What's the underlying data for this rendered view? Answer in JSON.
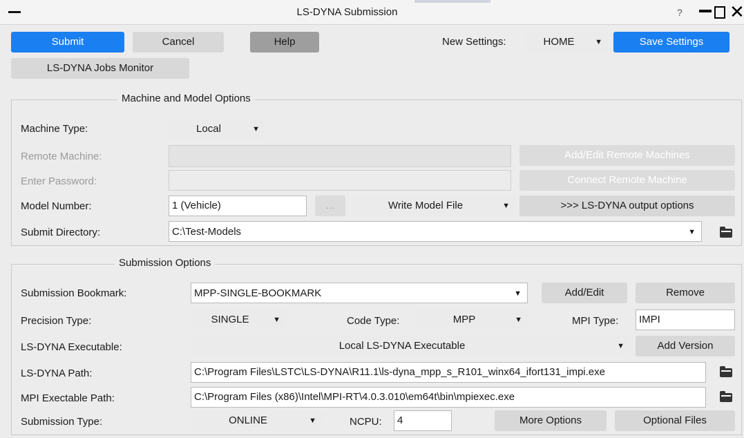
{
  "window": {
    "title": "LS-DYNA Submission",
    "help_glyph": "?",
    "close_glyph": "✕"
  },
  "toolbar": {
    "submit": "Submit",
    "cancel": "Cancel",
    "help": "Help",
    "new_settings_label": "New Settings:",
    "new_settings_value": "HOME",
    "save_settings": "Save Settings",
    "jobs_monitor": "LS-DYNA Jobs Monitor"
  },
  "machine": {
    "section_title": "Machine and Model Options",
    "machine_type_label": "Machine Type:",
    "machine_type_value": "Local",
    "remote_machine_label": "Remote Machine:",
    "add_edit_remote": "Add/Edit Remote Machines",
    "enter_password_label": "Enter Password:",
    "connect_remote": "Connect Remote Machine",
    "model_number_label": "Model Number:",
    "model_number_value": "1 (Vehicle)",
    "ellipsis": "...",
    "write_model_value": "Write Model File",
    "output_options": ">>> LS-DYNA output options",
    "submit_dir_label": "Submit Directory:",
    "submit_dir_value": "C:\\Test-Models"
  },
  "submission": {
    "section_title": "Submission Options",
    "bookmark_label": "Submission Bookmark:",
    "bookmark_value": "MPP-SINGLE-BOOKMARK",
    "add_edit": "Add/Edit",
    "remove": "Remove",
    "precision_label": "Precision Type:",
    "precision_value": "SINGLE",
    "code_type_label": "Code Type:",
    "code_type_value": "MPP",
    "mpi_type_label": "MPI Type:",
    "mpi_type_value": "IMPI",
    "executable_label": "LS-DYNA Executable:",
    "executable_value": "Local LS-DYNA Executable",
    "add_version": "Add Version",
    "path_label": "LS-DYNA Path:",
    "path_value": "C:\\Program Files\\LSTC\\LS-DYNA\\R11.1\\ls-dyna_mpp_s_R101_winx64_ifort131_impi.exe",
    "mpi_path_label": "MPI Exectable Path:",
    "mpi_path_value": "C:\\Program Files (x86)\\Intel\\MPI-RT\\4.0.3.010\\em64t\\bin\\mpiexec.exe",
    "type_label": "Submission Type:",
    "type_value": "ONLINE",
    "ncpu_label": "NCPU:",
    "ncpu_value": "4",
    "more_options": "More Options",
    "optional_files": "Optional Files"
  },
  "icons": {
    "dropdown": "▼",
    "folder": "folder-icon"
  },
  "colors": {
    "accent": "#1a7ff0",
    "background": "#ececec"
  }
}
